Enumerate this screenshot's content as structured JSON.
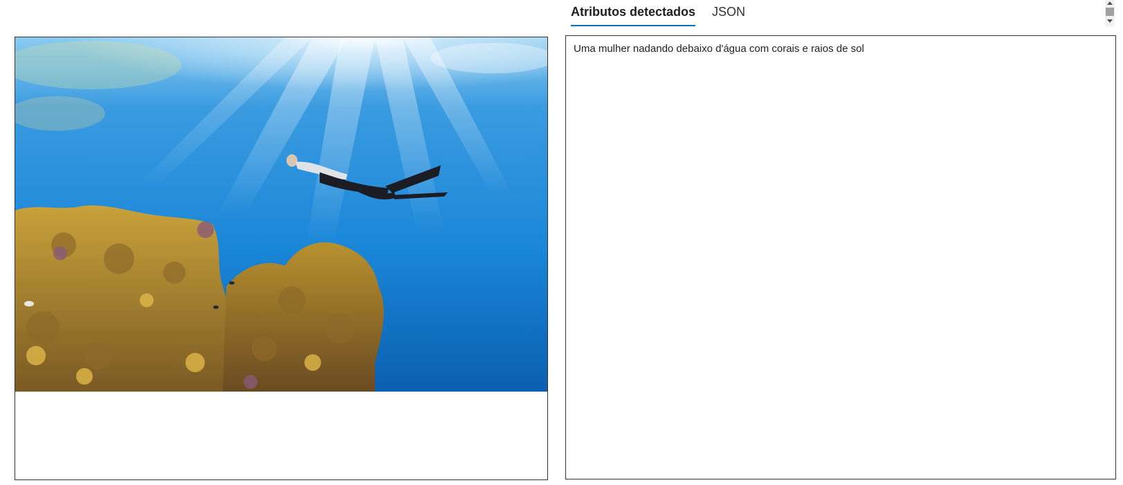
{
  "tabs": [
    {
      "label": "Atributos detectados",
      "active": true
    },
    {
      "label": "JSON",
      "active": false
    }
  ],
  "result": {
    "caption": "Uma mulher nadando debaixo d'água com corais e raios de sol"
  },
  "colors": {
    "tab_underline": "#0f6cbd",
    "border": "#333333",
    "water_top": "#6fb3e6",
    "water_deep": "#0b5fb0"
  },
  "image": {
    "icon": "underwater-photo"
  }
}
